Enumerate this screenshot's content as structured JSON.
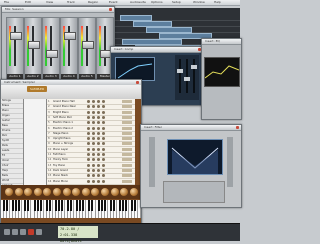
{
  "menubar": {
    "items": [
      "File",
      "Edit",
      "View",
      "Track",
      "Region",
      "Event",
      "Audiosuite",
      "Options",
      "Setup",
      "Window",
      "Help"
    ]
  },
  "mixer": {
    "title": "Mix: Session",
    "strips": [
      "Audio 1",
      "Audio 2",
      "Audio 3",
      "Audio 4",
      "Audio 5",
      "Master"
    ]
  },
  "plugin": {
    "title": "Insert: Comp"
  },
  "eq": {
    "title": "Insert: EQ"
  },
  "sampler": {
    "title": "Instrument: Sampler",
    "brand": "SAMPLER",
    "list_items": [
      "Strings",
      "Brass",
      "Piano",
      "Organ",
      "Guitar",
      "Bass",
      "Drums",
      "Perc",
      "Synth",
      "Pads",
      "Leads",
      "FX",
      "Vocal",
      "Choir",
      "Harp",
      "Bells",
      "World",
      "Ambient",
      "Loops",
      "User"
    ],
    "rows": [
      {
        "n": "1",
        "name": "Grand Piano Hall"
      },
      {
        "n": "2",
        "name": "Grand Piano Near"
      },
      {
        "n": "3",
        "name": "Bright Piano"
      },
      {
        "n": "4",
        "name": "Soft Piano Pad"
      },
      {
        "n": "5",
        "name": "Electric Piano 1"
      },
      {
        "n": "6",
        "name": "Electric Piano 2"
      },
      {
        "n": "7",
        "name": "Stage Piano"
      },
      {
        "n": "8",
        "name": "Upright Piano"
      },
      {
        "n": "9",
        "name": "Piano + Strings"
      },
      {
        "n": "10",
        "name": "Piano Layer"
      },
      {
        "n": "11",
        "name": "Felt Piano"
      },
      {
        "n": "12",
        "name": "Honky Tonk"
      },
      {
        "n": "13",
        "name": "Toy Piano"
      },
      {
        "n": "14",
        "name": "Dark Grand"
      },
      {
        "n": "15",
        "name": "Piano Stack"
      },
      {
        "n": "16",
        "name": "Piano Mono"
      }
    ]
  },
  "filter": {
    "title": "Insert: Filter"
  },
  "transport": {
    "counter": "70.2.80 / 2:01.338",
    "counter2": "Bars|Beats"
  },
  "colors": {
    "accent": "#b07a2c",
    "record": "#c23a2a",
    "counter_bg": "#d8e4c8"
  }
}
